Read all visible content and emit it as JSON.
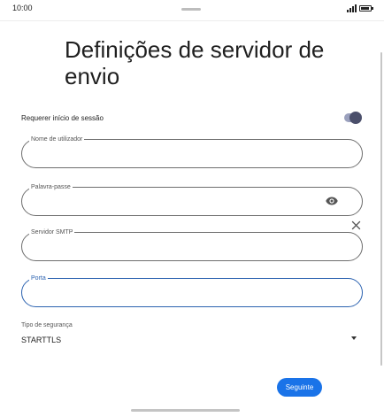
{
  "status_bar": {
    "time": "10:00",
    "icons": [
      "signal-icon",
      "battery-icon"
    ]
  },
  "page": {
    "title": "Definições de servidor de envio"
  },
  "require_signin": {
    "label": "Requerer início de sessão",
    "enabled": true
  },
  "fields": {
    "username": {
      "label": "Nome de utilizador",
      "value": ""
    },
    "password": {
      "label": "Palavra-passe",
      "value": "",
      "icons": [
        "eye-icon",
        "clear-icon"
      ]
    },
    "smtp_server": {
      "label": "Servidor SMTP",
      "value": ""
    },
    "port": {
      "label": "Porta",
      "value": "",
      "focused": true
    }
  },
  "security": {
    "label": "Tipo de segurança",
    "selected": "STARTTLS"
  },
  "actions": {
    "next_label": "Seguinte"
  },
  "colors": {
    "accent": "#1a73e8",
    "focus": "#2b62b0",
    "toggle_track": "#9aa0bd",
    "toggle_knob": "#4b4f6b"
  }
}
